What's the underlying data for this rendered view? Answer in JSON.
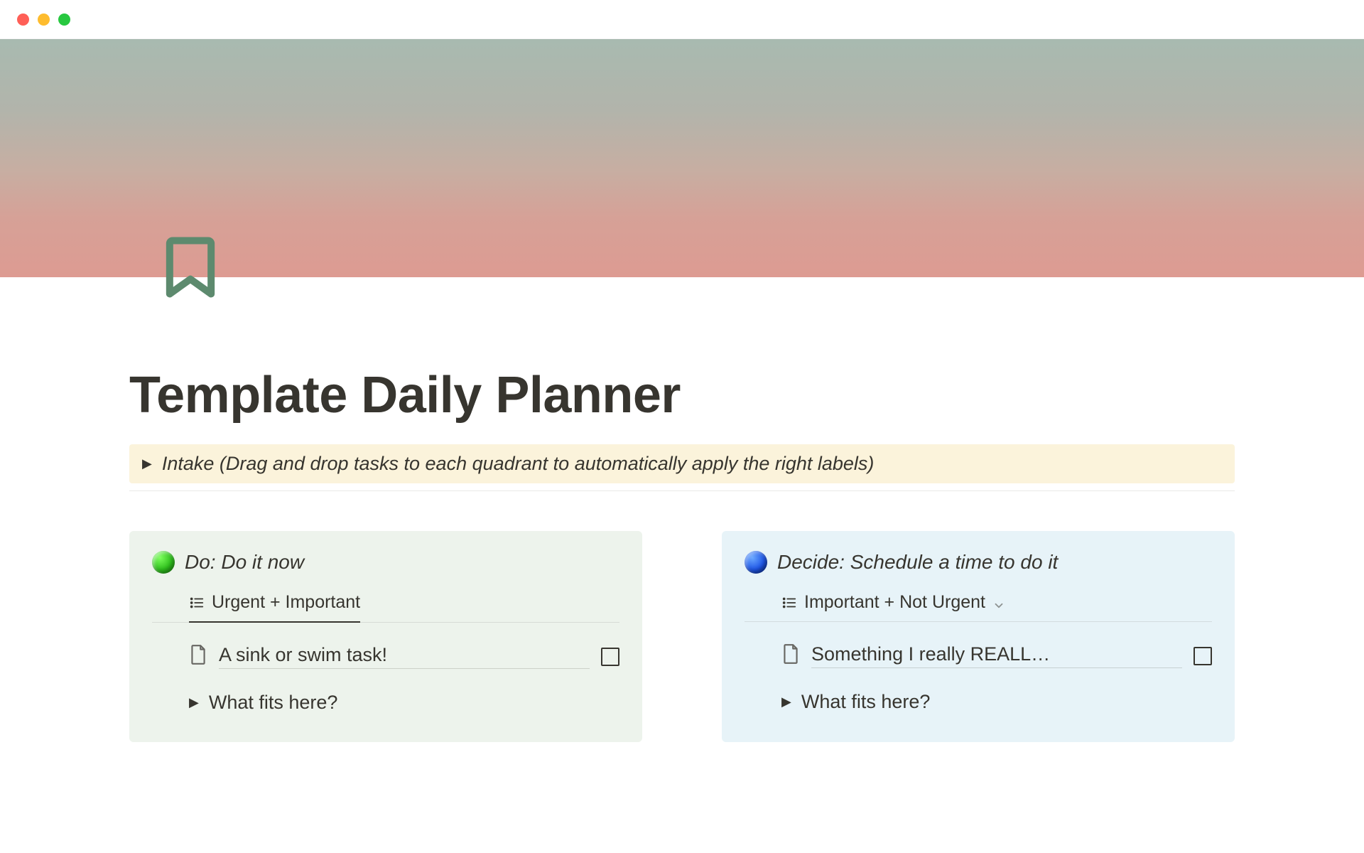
{
  "page": {
    "title": "Template Daily Planner"
  },
  "callout": {
    "text": "Intake (Drag and drop tasks to each quadrant to automatically apply the right labels)"
  },
  "quadrants": [
    {
      "id": "do",
      "dot_color": "green",
      "header": "Do: Do it now",
      "view_label": "Urgent + Important",
      "show_chevron": false,
      "task": "A sink or swim task!",
      "toggle": "What fits here?"
    },
    {
      "id": "decide",
      "dot_color": "blue",
      "header": "Decide: Schedule a time to do it",
      "view_label": "Important + Not Urgent",
      "show_chevron": true,
      "task": "Something I really REALL…",
      "toggle": "What fits here?"
    }
  ]
}
